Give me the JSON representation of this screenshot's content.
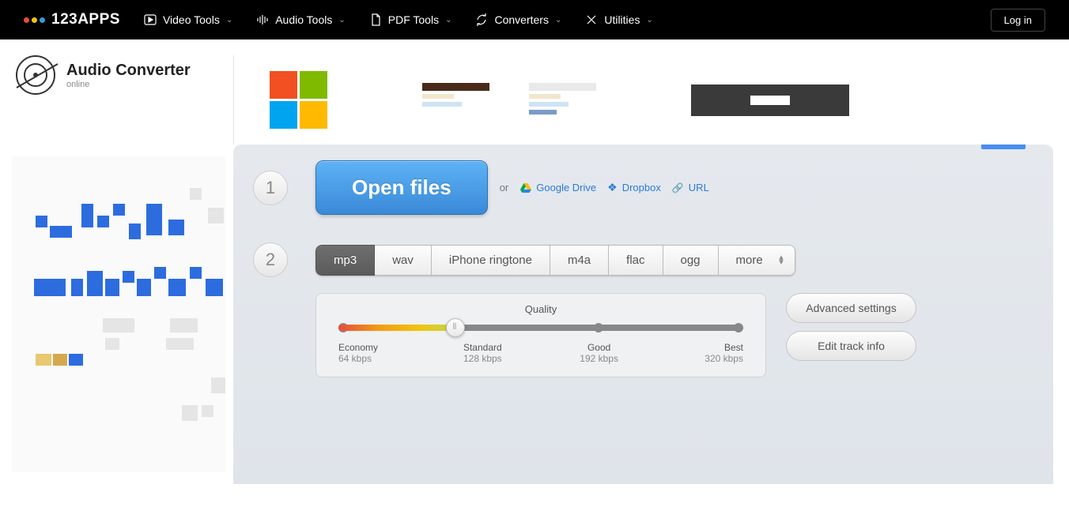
{
  "brand": "123APPS",
  "nav": {
    "video": "Video Tools",
    "audio": "Audio Tools",
    "pdf": "PDF Tools",
    "converters": "Converters",
    "utilities": "Utilities"
  },
  "login": "Log in",
  "app": {
    "title": "Audio Converter",
    "sub": "online"
  },
  "step1": {
    "num": "1",
    "open": "Open files",
    "or": "or",
    "gdrive": "Google Drive",
    "dropbox": "Dropbox",
    "url": "URL"
  },
  "step2": {
    "num": "2",
    "formats": {
      "mp3": "mp3",
      "wav": "wav",
      "iphone": "iPhone ringtone",
      "m4a": "m4a",
      "flac": "flac",
      "ogg": "ogg",
      "more": "more"
    },
    "quality": {
      "title": "Quality",
      "economy": {
        "label": "Economy",
        "rate": "64 kbps"
      },
      "standard": {
        "label": "Standard",
        "rate": "128 kbps"
      },
      "good": {
        "label": "Good",
        "rate": "192 kbps"
      },
      "best": {
        "label": "Best",
        "rate": "320 kbps"
      }
    },
    "advanced": "Advanced settings",
    "trackinfo": "Edit track info"
  }
}
